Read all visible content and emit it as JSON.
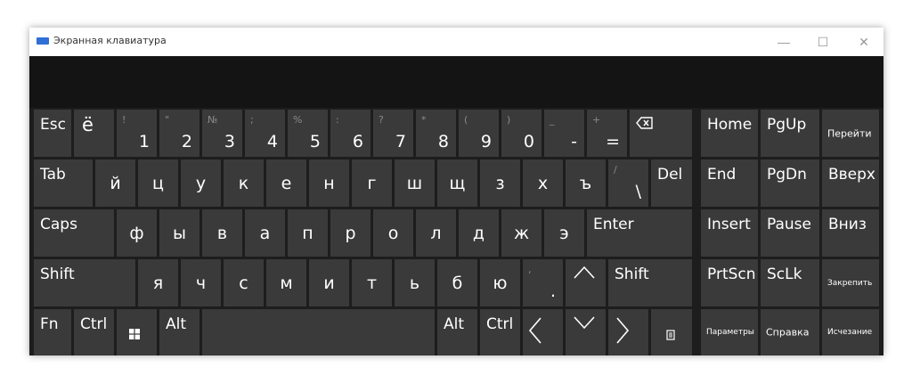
{
  "window": {
    "title": "Экранная клавиатура",
    "minimize_label": "—",
    "maximize_label": "☐",
    "close_label": "✕"
  },
  "keyboard": {
    "row1": {
      "esc": "Esc",
      "yo": "ё",
      "d1": {
        "shift": "!",
        "base": "1"
      },
      "d2": {
        "shift": "\"",
        "base": "2"
      },
      "d3": {
        "shift": "№",
        "base": "3"
      },
      "d4": {
        "shift": ";",
        "base": "4"
      },
      "d5": {
        "shift": "%",
        "base": "5"
      },
      "d6": {
        "shift": ":",
        "base": "6"
      },
      "d7": {
        "shift": "?",
        "base": "7"
      },
      "d8": {
        "shift": "*",
        "base": "8"
      },
      "d9": {
        "shift": "(",
        "base": "9"
      },
      "d0": {
        "shift": ")",
        "base": "0"
      },
      "minus": {
        "shift": "_",
        "base": "-"
      },
      "equals": {
        "shift": "+",
        "base": "="
      }
    },
    "row2": {
      "tab": "Tab",
      "letters": [
        "й",
        "ц",
        "у",
        "к",
        "е",
        "н",
        "г",
        "ш",
        "щ",
        "з",
        "х",
        "ъ"
      ],
      "backslash": {
        "shift": "/",
        "base": "\\"
      },
      "del": "Del"
    },
    "row3": {
      "caps": "Caps",
      "letters": [
        "ф",
        "ы",
        "в",
        "а",
        "п",
        "р",
        "о",
        "л",
        "д",
        "ж",
        "э"
      ],
      "enter": "Enter"
    },
    "row4": {
      "shift_left": "Shift",
      "letters": [
        "я",
        "ч",
        "с",
        "м",
        "и",
        "т",
        "ь",
        "б",
        "ю"
      ],
      "period": {
        "shift": ",",
        "base": "."
      },
      "shift_right": "Shift"
    },
    "row5": {
      "fn": "Fn",
      "ctrl_left": "Ctrl",
      "alt_left": "Alt",
      "alt_right": "Alt",
      "ctrl_right": "Ctrl"
    }
  },
  "nav": {
    "home": "Home",
    "pgup": "PgUp",
    "goto": "Перейти",
    "end": "End",
    "pgdn": "PgDn",
    "up": "Вверх",
    "insert": "Insert",
    "pause": "Pause",
    "down": "Вниз",
    "prtscn": "PrtScn",
    "sclk": "ScLk",
    "dock": "Закрепить",
    "options": "Параметры",
    "help": "Справка",
    "fade": "Исчезание"
  }
}
